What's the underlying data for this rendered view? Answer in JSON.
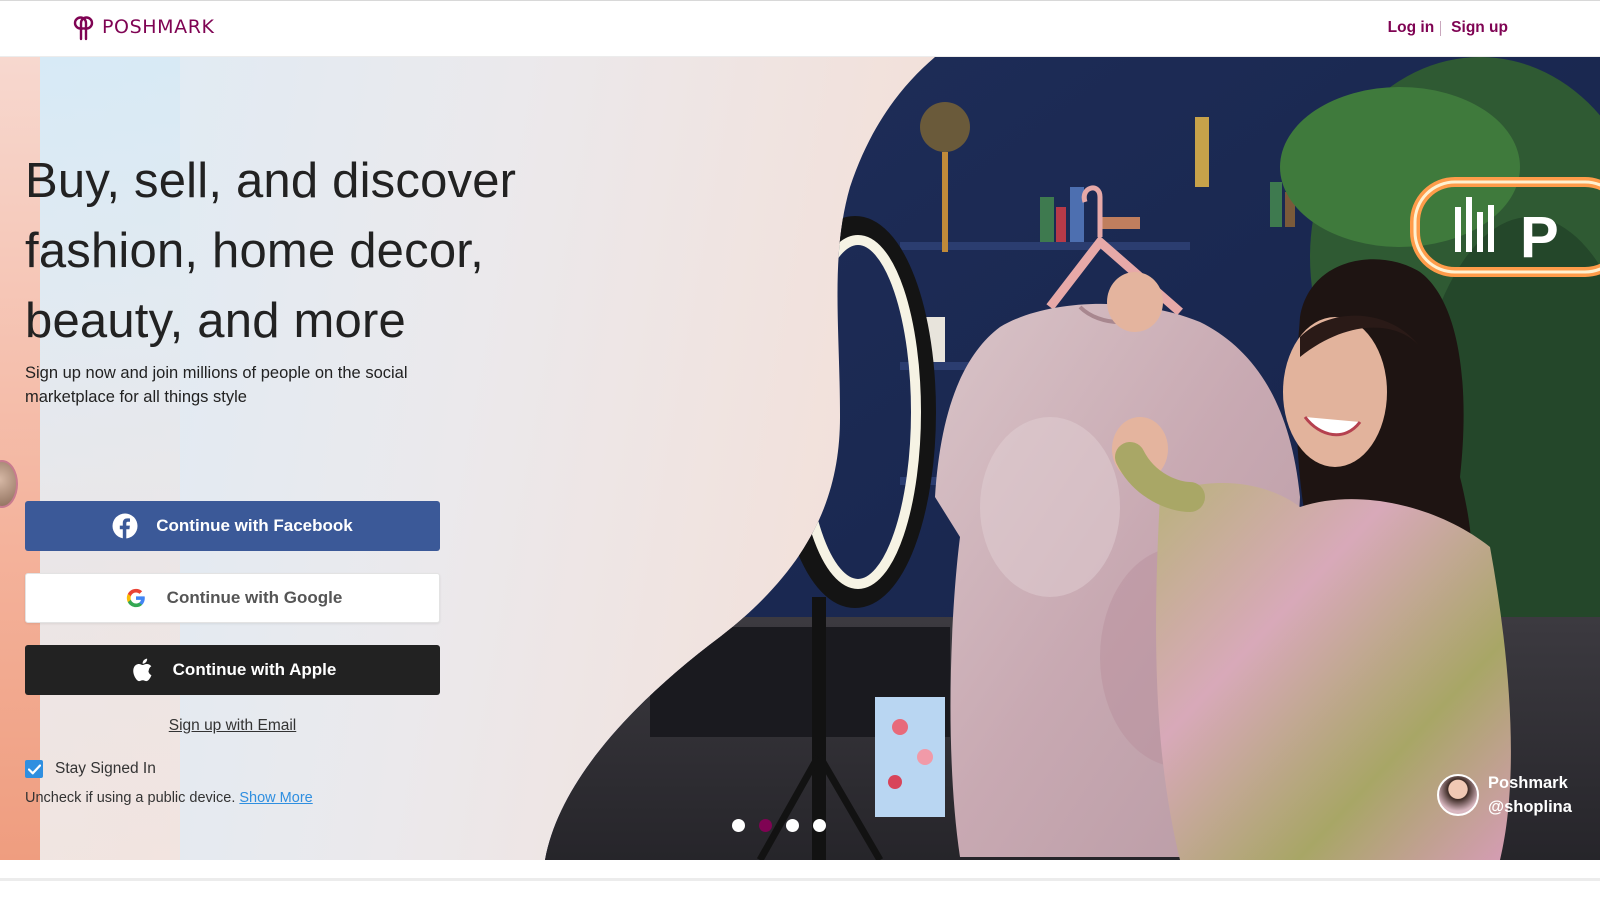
{
  "header": {
    "brand": "POSHMARK",
    "login_label": "Log in",
    "signup_label": "Sign up"
  },
  "hero": {
    "headline": "Buy, sell, and discover fashion, home decor, beauty, and more",
    "subline": "Sign up now and join millions of people on the social marketplace for all things style",
    "buttons": {
      "facebook": "Continue with Facebook",
      "google": "Continue with Google",
      "apple": "Continue with Apple"
    },
    "email_link": "Sign up with Email",
    "stay_signed_in": "Stay Signed In",
    "stay_checked": true,
    "uncheck_note": "Uncheck if using a public device.",
    "show_more": "Show More",
    "carousel": {
      "total": 4,
      "active_index": 1
    },
    "credit": {
      "line1": "Poshmark",
      "line2": "@shoplina"
    }
  },
  "colors": {
    "brand": "#7f0353",
    "facebook": "#3b5998",
    "apple": "#222222",
    "link": "#2f8fe0"
  },
  "icons": [
    "poshmark-logo-icon",
    "facebook-icon",
    "google-icon",
    "apple-icon",
    "checkmark-icon"
  ]
}
